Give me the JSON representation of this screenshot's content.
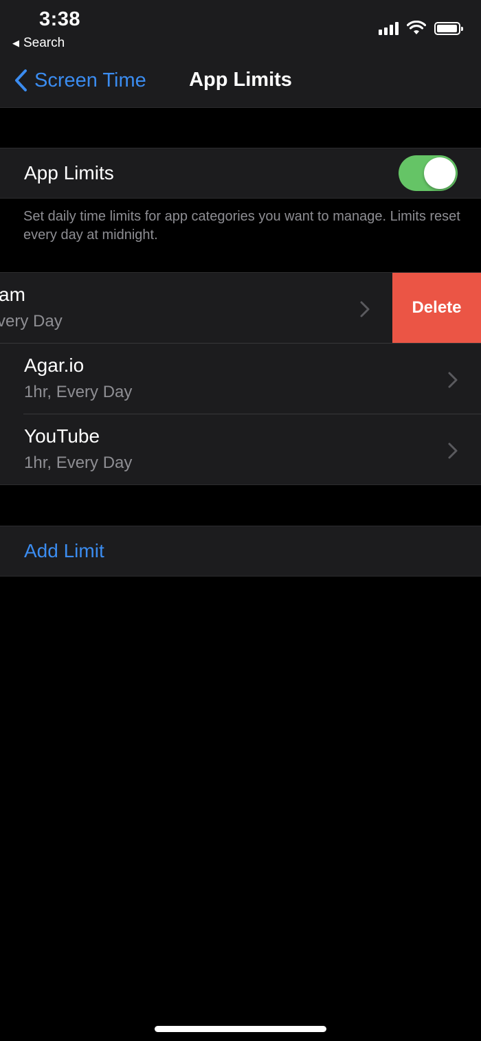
{
  "status_bar": {
    "time": "3:38",
    "back_app": "Search",
    "back_icon": "triangle-left-icon",
    "icons": [
      "cellular-signal-icon",
      "wifi-icon",
      "battery-icon"
    ]
  },
  "nav": {
    "back_label": "Screen Time",
    "title": "App Limits"
  },
  "app_limits_toggle": {
    "label": "App Limits",
    "on": true
  },
  "description": "Set daily time limits for app categories you want to manage. Limits reset every day at midnight.",
  "limits": [
    {
      "name": "am",
      "detail": "very Day",
      "swiped": true
    },
    {
      "name": "Agar.io",
      "detail": "1hr, Every Day"
    },
    {
      "name": "YouTube",
      "detail": "1hr, Every Day"
    }
  ],
  "delete_label": "Delete",
  "add_limit_label": "Add Limit",
  "colors": {
    "accent": "#3b8cf0",
    "toggle_on": "#65c466",
    "delete": "#eb5545",
    "cell_background": "#1c1c1e",
    "secondary_text": "#8e8e93"
  }
}
